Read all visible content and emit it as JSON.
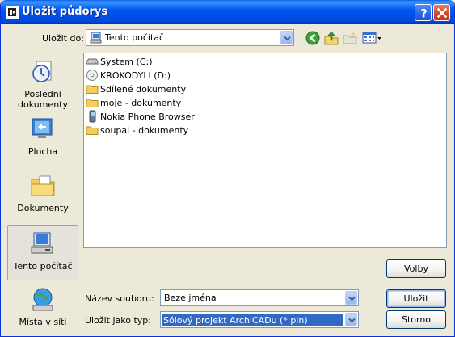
{
  "window": {
    "title": "Uložit půdorys"
  },
  "toolbar": {
    "save_in_label": "Uložit do:",
    "save_in_value": "Tento počítač",
    "icons": [
      "back-icon",
      "up-folder-icon",
      "new-folder-icon",
      "views-menu-icon"
    ]
  },
  "places": [
    {
      "label": "Poslední dokumenty",
      "icon": "recent-documents-icon"
    },
    {
      "label": "Plocha",
      "icon": "desktop-icon"
    },
    {
      "label": "Dokumenty",
      "icon": "documents-folder-icon"
    },
    {
      "label": "Tento počítač",
      "icon": "my-computer-icon"
    },
    {
      "label": "Místa v síti",
      "icon": "network-places-icon"
    }
  ],
  "files": [
    {
      "name": "System (C:)",
      "icon": "hard-drive-icon"
    },
    {
      "name": "KROKODYLI (D:)",
      "icon": "cd-drive-icon"
    },
    {
      "name": "Sdílené dokumenty",
      "icon": "folder-icon"
    },
    {
      "name": "moje - dokumenty",
      "icon": "folder-icon"
    },
    {
      "name": "Nokia Phone Browser",
      "icon": "phone-browser-icon"
    },
    {
      "name": "soupal - dokumenty",
      "icon": "folder-icon"
    }
  ],
  "form": {
    "filename_label": "Název souboru:",
    "filename_value": "Beze jména",
    "filetype_label": "Uložit jako typ:",
    "filetype_value": "Sólový projekt ArchiCADu (*.pln)"
  },
  "buttons": {
    "options": "Volby",
    "save": "Uložit",
    "cancel": "Storno"
  },
  "colors": {
    "titlebar": "#0058ee",
    "selection": "#316ac5",
    "face": "#ece9d8"
  }
}
